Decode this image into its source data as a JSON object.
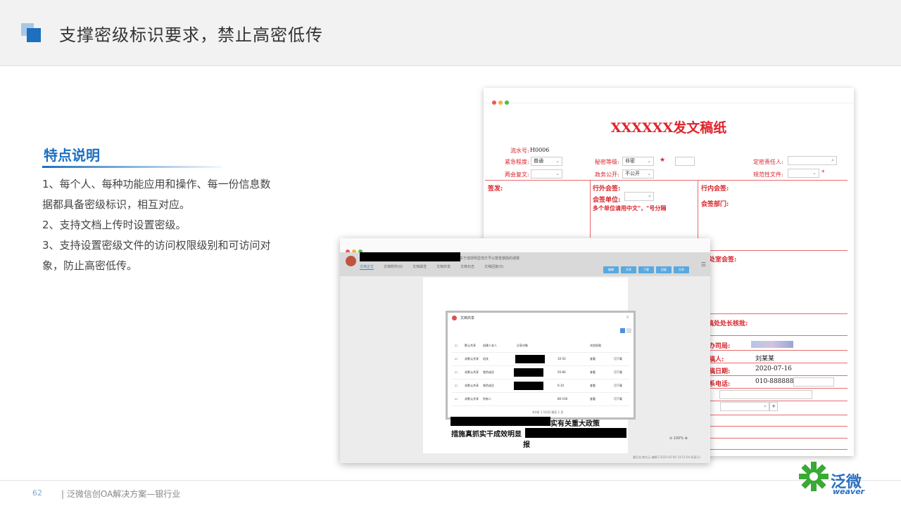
{
  "header": {
    "title": "支撑密级标识要求，禁止高密低传"
  },
  "features": {
    "title": "特点说明",
    "items": [
      "1、每个人、每种功能应用和操作、每一份信息数据都具备密级标识，相互对应。",
      "2、支持文档上传时设置密级。",
      "3、支持设置密级文件的访问权限级别和可访问对象，防止高密低传。"
    ]
  },
  "form": {
    "title": "XXXXXX发文稿纸",
    "serial_label": "流水号:",
    "serial_value": "H0006",
    "urgency_label": "紧急程度:",
    "urgency_value": "普通",
    "secret_label": "秘密等级:",
    "secret_value": "非密",
    "owner_label": "定密责任人:",
    "reply_label": "两会复文:",
    "public_label": "政务公开:",
    "public_value": "不公开",
    "normative_label": "规范性文件:",
    "sign_label": "签发:",
    "external_label": "行外会签:",
    "sign_unit_label": "会签单位:",
    "multi_unit_note": "多个单位请用中文\"，\"号分隔",
    "internal_label": "行内会签:",
    "sign_dept_label": "会签部门:",
    "office_label": "处室会签:",
    "head_label": "稿处处长核批:",
    "bureau_label": "办司局:",
    "drafter_label": "稿人:",
    "drafter_value": "刘某某",
    "date_label": "稿日期:",
    "date_value": "2020-07-16",
    "phone_label": "系电话:",
    "phone_value": "010-88888888"
  },
  "viewer": {
    "doc_title": "关于成效明显地方予以督查激励的通报",
    "tabs": [
      "文档正文",
      "文档附件(0)",
      "文档属性",
      "文档共享",
      "文档日志",
      "文档回复(0)"
    ],
    "buttons": [
      "编辑",
      "共享",
      "下载",
      "回复",
      "分享"
    ],
    "dialog_title": "文档共享",
    "table_headers": [
      "默认共享",
      "创建人本人",
      "分享对象",
      "",
      "浏览权限",
      ""
    ],
    "rows": [
      [
        "非默认共享",
        "机关",
        "",
        "10-50",
        "查看",
        "可下载"
      ],
      [
        "非默认共享",
        "角色成员",
        "",
        "50-80",
        "查看",
        "可下载"
      ],
      [
        "非默认共享",
        "角色成员",
        "",
        "0-10",
        "查看",
        "可下载"
      ],
      [
        "非默认共享",
        "所有人",
        "",
        "80-100",
        "查看",
        "可下载"
      ]
    ],
    "pager": "共4条  1  10/页  跳至 1 页",
    "doc_line1": "实有关重大政策",
    "doc_line2": "措施真抓实干成效明显",
    "doc_line3": "报",
    "zoom": "100%",
    "footer": "最后由  韩文元  编辑于2020-05-09 14:52:04  阅读(1)"
  },
  "footer": {
    "page": "62",
    "text": "| 泛微信创OA解决方案—银行业",
    "logo_cn": "泛微",
    "logo_en": "weaver"
  },
  "colors": {
    "accent": "#1d6fc0",
    "form_red": "#e0232b",
    "logo_green": "#3aa935"
  }
}
